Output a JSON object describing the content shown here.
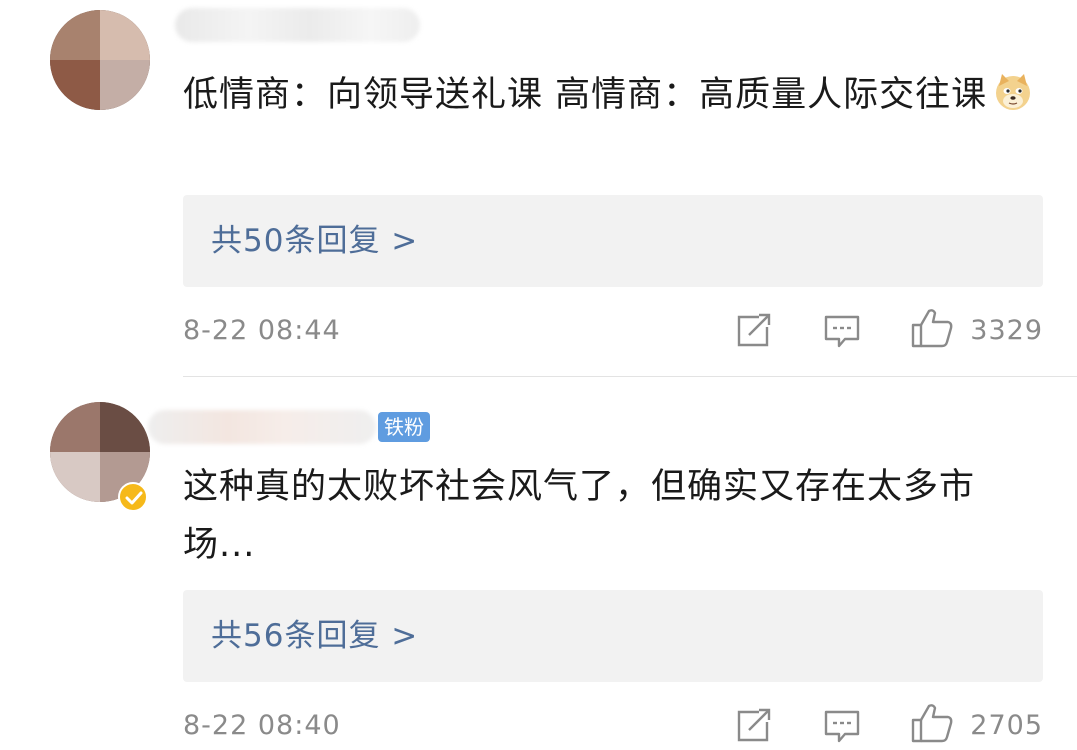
{
  "comments": [
    {
      "text": "低情商：向领导送礼课 高情商：高质量人际交往课",
      "emoji": "doge-emoji",
      "reply_link": "共50条回复 >",
      "timestamp": "8-22 08:44",
      "like_count": "3329"
    },
    {
      "badge": "铁粉",
      "text": "这种真的太败坏社会风气了，但确实又存在太多市场...",
      "reply_link": "共56条回复 >",
      "timestamp": "8-22 08:40",
      "like_count": "2705"
    }
  ],
  "icons": {
    "repost": "repost-icon",
    "comment": "comment-icon",
    "like": "like-icon",
    "verified": "verified-icon"
  },
  "colors": {
    "link": "#4e6d98",
    "meta_text": "#8a8a8a",
    "reply_bg": "#f2f2f2",
    "fan_badge": "#5f9ce0",
    "verified": "#f6b91a"
  }
}
